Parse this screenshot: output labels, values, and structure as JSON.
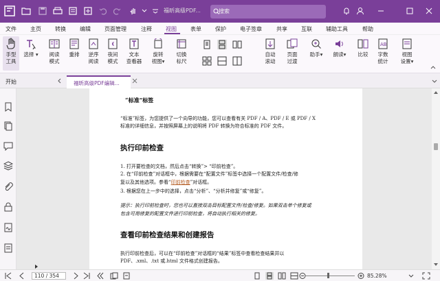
{
  "titlebar": {
    "doc_title": "福昕高级PDF...",
    "search_placeholder": "搜索"
  },
  "menu": {
    "items": [
      "文件",
      "主页",
      "转换",
      "编辑",
      "页面管理",
      "注释",
      "视图",
      "表单",
      "保护",
      "电子签章",
      "共享",
      "互联",
      "辅助工具",
      "帮助"
    ],
    "active": "视图"
  },
  "ribbon": {
    "hand_tool": [
      "手型",
      "工具"
    ],
    "select": [
      "选择"
    ],
    "read_mode": [
      "阅读",
      "模式"
    ],
    "reflow": [
      "重排"
    ],
    "reverse_read": [
      "逆序",
      "阅读"
    ],
    "night_mode": [
      "夜间",
      "模式"
    ],
    "text_viewer": [
      "文本",
      "查看器"
    ],
    "rotate_view": [
      "旋转",
      "视图"
    ],
    "switch_ruler": [
      "切换",
      "标尺"
    ],
    "auto_scroll": [
      "自动",
      "滚动"
    ],
    "page_transition": [
      "页面",
      "过渡"
    ],
    "assistant": [
      "助手"
    ],
    "read_aloud": [
      "朗读"
    ],
    "compare": [
      "比较"
    ],
    "word_count": [
      "字数",
      "统计"
    ],
    "view_settings": [
      "视图",
      "设置"
    ]
  },
  "tabs": {
    "start": "开始",
    "document": "福昕高级PDF编辑..."
  },
  "page": {
    "h_standard": "“标准”标签",
    "standard_lines": [
      "“标准”标签，为您提供了一个向导的功能，您可以查看有关 PDF / A、PDF / E 或 PDF / X",
      "标准的详细信息，并按照屏幕上的说明将 PDF 转换为符合标准的 PDF 文件。"
    ],
    "h_preflight": "执行印前检查",
    "steps": [
      "1.   打开要检查的文档，然后点击“转换”> “印前检查”。",
      "2.   在“印前检查”对话框中，根据需要在“配置文件”标签中选择一个配置文件/检查/修",
      "      复以及其他选项。参看“",
      "印前检查",
      "”对话框。",
      "3.   根据您在上一步中的选择，点击“分析”、“分析并修复”或“修复”。"
    ],
    "tip_lines": [
      "提示：执行印前检查时，您也可以直接双击目标配置文件/检查/修复。如果双击单个修复或",
      "包含可用修复的配置文件进行印前检查，将自动执行相关的修复。"
    ],
    "h_report": "查看印前检查结果和创建报告",
    "report_lines": [
      "执行印前检查后，可以在“印前检查”对话框的“结果”标签中查看检查结果并以",
      "PDF、.xml、.txt 或.html 文件格式创建报告。"
    ]
  },
  "status": {
    "page_indicator": "110 / 354",
    "zoom": "85.28%",
    "zoom_level": 0.47
  },
  "colors": {
    "brand": "#7a3f99",
    "link": "#b35a1f"
  }
}
